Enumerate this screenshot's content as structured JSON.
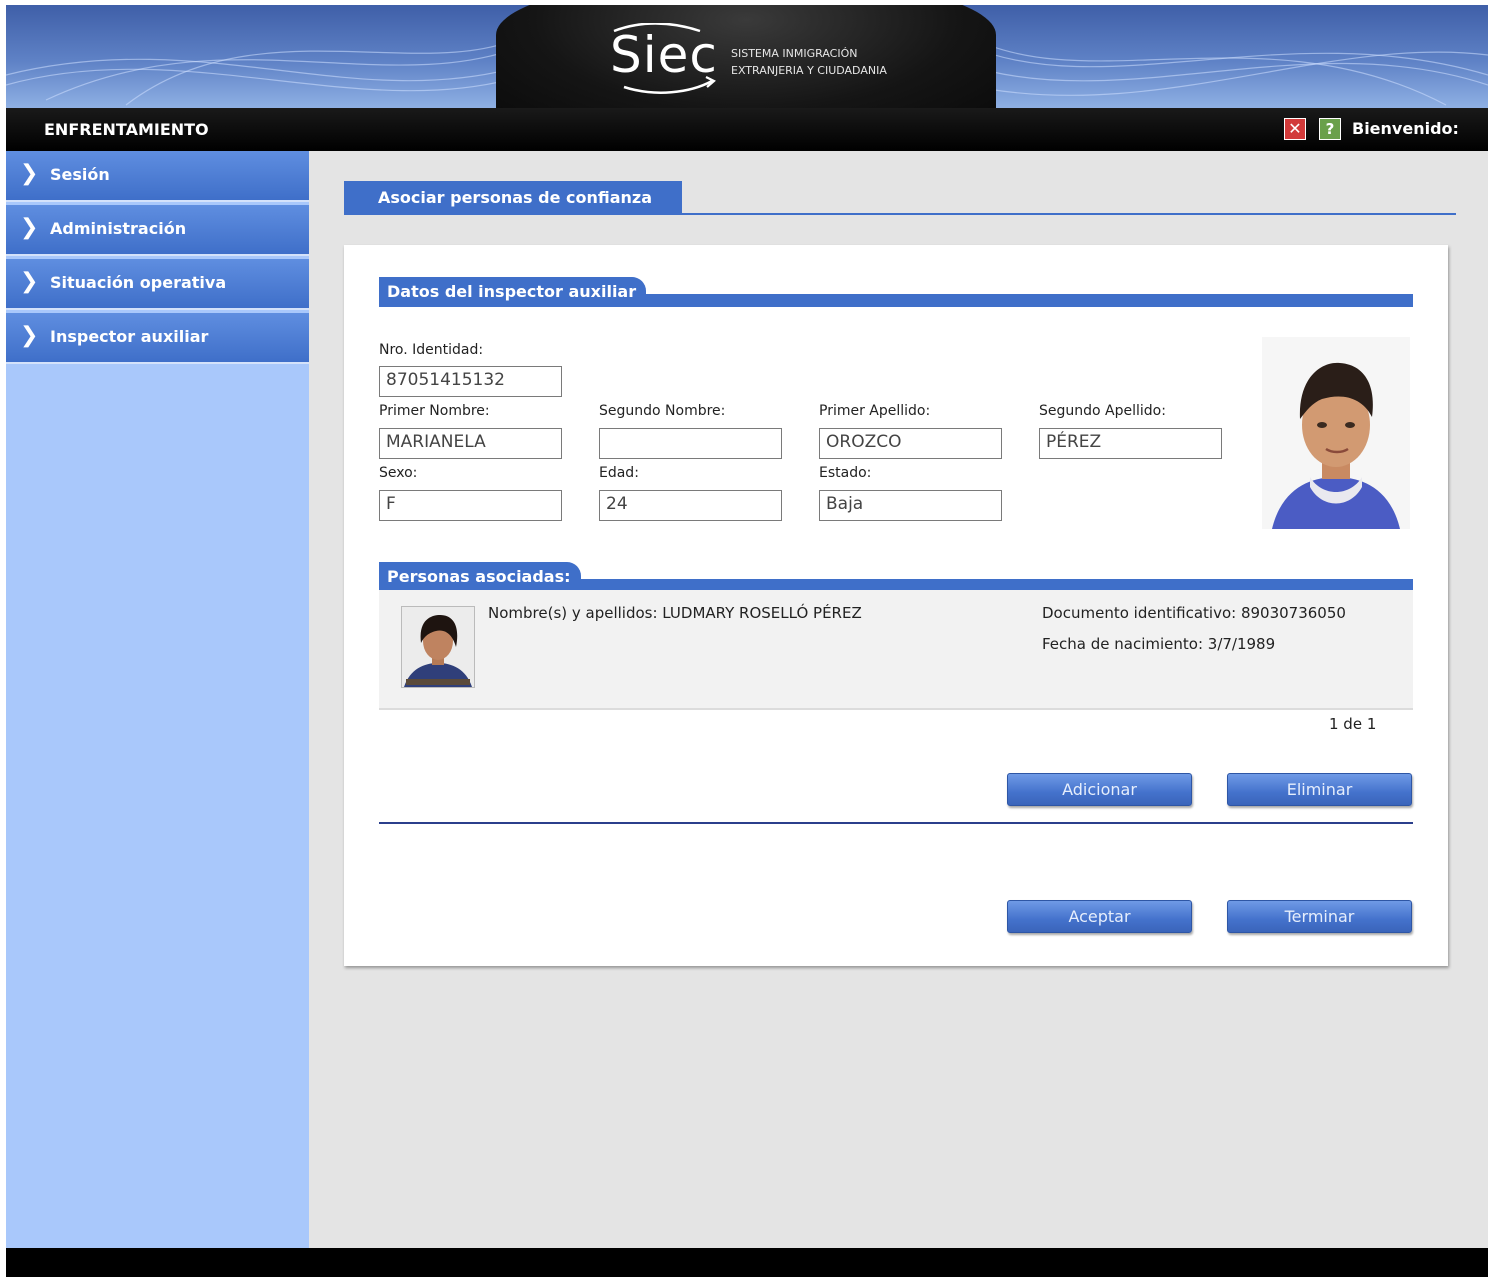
{
  "header": {
    "logo": "Siec",
    "system_line1": "SISTEMA INMIGRACIÓN",
    "system_line2": "EXTRANJERIA Y CIUDADANIA"
  },
  "topbar": {
    "title": "ENFRENTAMIENTO",
    "close_icon": "✕",
    "help_icon": "?",
    "welcome": "Bienvenido:"
  },
  "sidebar": {
    "items": [
      {
        "label": "Sesión",
        "icon": "chevron-right-icon"
      },
      {
        "label": "Administración",
        "icon": "chevron-right-icon"
      },
      {
        "label": "Situación operativa",
        "icon": "chevron-right-icon"
      },
      {
        "label": "Inspector auxiliar",
        "icon": "chevron-right-icon"
      }
    ]
  },
  "page": {
    "title": "Asociar personas de confianza"
  },
  "inspector": {
    "section_title": "Datos del inspector auxiliar",
    "id_label": "Nro. Identidad:",
    "id_value": "87051415132",
    "first_name_label": "Primer Nombre:",
    "first_name_value": "MARIANELA",
    "second_name_label": "Segundo Nombre:",
    "second_name_value": "",
    "first_surname_label": "Primer Apellido:",
    "first_surname_value": "OROZCO",
    "second_surname_label": "Segundo Apellido:",
    "second_surname_value": "PÉREZ",
    "sex_label": "Sexo:",
    "sex_value": "F",
    "age_label": "Edad:",
    "age_value": "24",
    "status_label": "Estado:",
    "status_value": "Baja"
  },
  "associated": {
    "section_title": "Personas asociadas:",
    "persons": [
      {
        "name": "Nombre(s) y apellidos: LUDMARY ROSELLÓ PÉREZ",
        "document": "Documento identificativo: 89030736050",
        "birth": "Fecha de nacimiento: 3/7/1989"
      }
    ],
    "pager": "1 de 1"
  },
  "buttons": {
    "add": "Adicionar",
    "remove": "Eliminar",
    "accept": "Aceptar",
    "finish": "Terminar"
  },
  "colors": {
    "brand_blue": "#3f6fc9",
    "sidebar_bg": "#a9c8fb",
    "main_bg": "#e4e4e4",
    "topbar": "#000000"
  }
}
